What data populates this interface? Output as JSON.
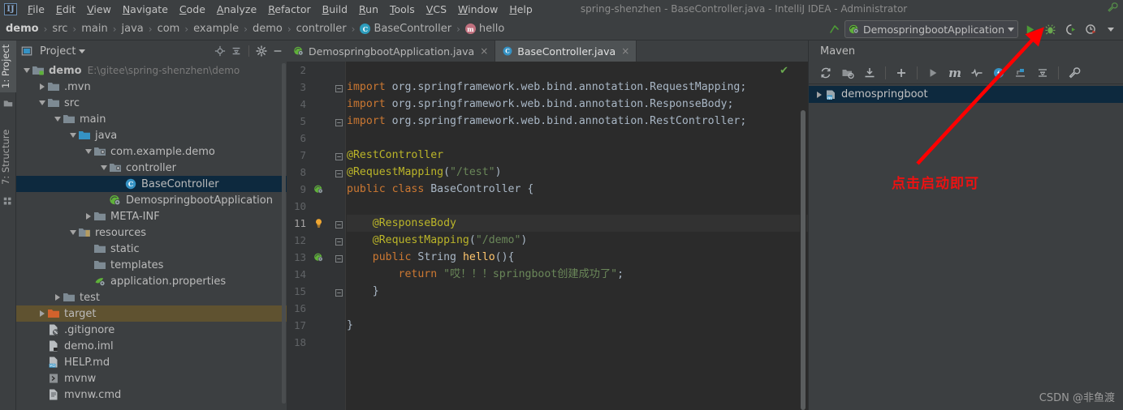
{
  "window": {
    "title": "spring-shenzhen - BaseController.java - IntelliJ IDEA - Administrator",
    "logo": "IJ"
  },
  "menubar": {
    "items": [
      {
        "label": "File",
        "mnemonic": "F"
      },
      {
        "label": "Edit",
        "mnemonic": "E"
      },
      {
        "label": "View",
        "mnemonic": "V"
      },
      {
        "label": "Navigate",
        "mnemonic": "N"
      },
      {
        "label": "Code",
        "mnemonic": "C"
      },
      {
        "label": "Analyze",
        "mnemonic": "A"
      },
      {
        "label": "Refactor",
        "mnemonic": "R"
      },
      {
        "label": "Build",
        "mnemonic": "B"
      },
      {
        "label": "Run",
        "mnemonic": "R"
      },
      {
        "label": "Tools",
        "mnemonic": "T"
      },
      {
        "label": "VCS",
        "mnemonic": "V"
      },
      {
        "label": "Window",
        "mnemonic": "W"
      },
      {
        "label": "Help",
        "mnemonic": "H"
      }
    ]
  },
  "breadcrumb": {
    "separator": "›",
    "items": [
      {
        "label": "demo",
        "icon": "none",
        "bold": true
      },
      {
        "label": "src",
        "icon": "none",
        "bold": false
      },
      {
        "label": "main",
        "icon": "none",
        "bold": false
      },
      {
        "label": "java",
        "icon": "none",
        "bold": false
      },
      {
        "label": "com",
        "icon": "none",
        "bold": false
      },
      {
        "label": "example",
        "icon": "none",
        "bold": false
      },
      {
        "label": "demo",
        "icon": "none",
        "bold": false
      },
      {
        "label": "controller",
        "icon": "none",
        "bold": false
      },
      {
        "label": "BaseController",
        "icon": "class-icon",
        "icon_letter": "C",
        "bold": false
      },
      {
        "label": "hello",
        "icon": "method-icon",
        "icon_letter": "m",
        "bold": false
      }
    ]
  },
  "run_toolbar": {
    "config_name": "DemospringbootApplication",
    "config_icon": "spring-boot-icon",
    "dropdown_icon": "chevron-down-icon",
    "buttons": [
      {
        "name": "run-button",
        "icon": "play-icon",
        "color": "#4d9a36"
      },
      {
        "name": "debug-button",
        "icon": "bug-icon",
        "color": "#6aa84f"
      },
      {
        "name": "run-with-coverage-button",
        "icon": "coverage-icon",
        "color": "#b0b0b0"
      },
      {
        "name": "profile-button",
        "icon": "profiler-icon",
        "color": "#b0b0b0"
      }
    ],
    "updown_icon": "updown-arrow-icon"
  },
  "tool_strip": {
    "tabs": [
      {
        "label": "1: Project",
        "active": true,
        "name": "tool-tab-project"
      },
      {
        "label": "7: Structure",
        "active": false,
        "name": "tool-tab-structure"
      }
    ]
  },
  "project_panel": {
    "title": "Project",
    "title_icon": "project-view-icon",
    "title_dropdown_icon": "chevron-down-icon",
    "toolbar": [
      {
        "name": "locate-icon",
        "label": "Select Opened File"
      },
      {
        "name": "collapse-all-icon",
        "label": "Collapse All"
      },
      {
        "name": "gear-icon",
        "label": "Settings"
      },
      {
        "name": "minimize-icon",
        "label": "Hide"
      }
    ],
    "tree": [
      {
        "label": "demo",
        "path": "E:\\gitee\\spring-shenzhen\\demo",
        "indent": 0,
        "arrow": "down",
        "icon": "module-folder-icon",
        "state": "normal",
        "bold": true
      },
      {
        "label": ".mvn",
        "path": "",
        "indent": 1,
        "arrow": "right",
        "icon": "folder-icon",
        "state": "normal",
        "bold": false
      },
      {
        "label": "src",
        "path": "",
        "indent": 1,
        "arrow": "down",
        "icon": "folder-icon",
        "state": "normal",
        "bold": false
      },
      {
        "label": "main",
        "path": "",
        "indent": 2,
        "arrow": "down",
        "icon": "folder-icon",
        "state": "normal",
        "bold": false
      },
      {
        "label": "java",
        "path": "",
        "indent": 3,
        "arrow": "down",
        "icon": "source-folder-icon",
        "state": "normal",
        "bold": false
      },
      {
        "label": "com.example.demo",
        "path": "",
        "indent": 4,
        "arrow": "down",
        "icon": "package-icon",
        "state": "normal",
        "bold": false
      },
      {
        "label": "controller",
        "path": "",
        "indent": 5,
        "arrow": "down",
        "icon": "package-icon",
        "state": "normal",
        "bold": false
      },
      {
        "label": "BaseController",
        "path": "",
        "indent": 6,
        "arrow": "none",
        "icon": "java-class-icon",
        "state": "selected",
        "bold": false
      },
      {
        "label": "DemospringbootApplication",
        "path": "",
        "indent": 5,
        "arrow": "none",
        "icon": "spring-boot-icon",
        "state": "normal",
        "bold": false
      },
      {
        "label": "META-INF",
        "path": "",
        "indent": 4,
        "arrow": "right",
        "icon": "folder-icon",
        "state": "normal",
        "bold": false
      },
      {
        "label": "resources",
        "path": "",
        "indent": 3,
        "arrow": "down",
        "icon": "resources-folder-icon",
        "state": "normal",
        "bold": false
      },
      {
        "label": "static",
        "path": "",
        "indent": 4,
        "arrow": "none",
        "icon": "folder-icon",
        "state": "normal",
        "bold": false
      },
      {
        "label": "templates",
        "path": "",
        "indent": 4,
        "arrow": "none",
        "icon": "folder-icon",
        "state": "normal",
        "bold": false
      },
      {
        "label": "application.properties",
        "path": "",
        "indent": 4,
        "arrow": "none",
        "icon": "spring-properties-icon",
        "state": "normal",
        "bold": false
      },
      {
        "label": "test",
        "path": "",
        "indent": 2,
        "arrow": "right",
        "icon": "folder-icon",
        "state": "normal",
        "bold": false
      },
      {
        "label": "target",
        "path": "",
        "indent": 1,
        "arrow": "right",
        "icon": "excluded-folder-icon",
        "state": "highlight",
        "bold": false
      },
      {
        "label": ".gitignore",
        "path": "",
        "indent": 1,
        "arrow": "none",
        "icon": "gitignore-file-icon",
        "state": "normal",
        "bold": false
      },
      {
        "label": "demo.iml",
        "path": "",
        "indent": 1,
        "arrow": "none",
        "icon": "iml-file-icon",
        "state": "normal",
        "bold": false
      },
      {
        "label": "HELP.md",
        "path": "",
        "indent": 1,
        "arrow": "none",
        "icon": "markdown-file-icon",
        "state": "normal",
        "bold": false
      },
      {
        "label": "mvnw",
        "path": "",
        "indent": 1,
        "arrow": "none",
        "icon": "script-file-icon",
        "state": "normal",
        "bold": false
      },
      {
        "label": "mvnw.cmd",
        "path": "",
        "indent": 1,
        "arrow": "none",
        "icon": "cmd-file-icon",
        "state": "normal",
        "bold": false
      }
    ]
  },
  "editor": {
    "tabs": [
      {
        "label": "DemospringbootApplication.java",
        "icon": "spring-boot-icon",
        "active": false,
        "close_icon": "×"
      },
      {
        "label": "BaseController.java",
        "icon": "java-class-icon",
        "active": true,
        "close_icon": "×"
      }
    ],
    "inspection_status_icon": "checkmark-icon",
    "current_line": 11,
    "lines": [
      {
        "num": "2",
        "fold": "none",
        "gutter_icon": "",
        "html": ""
      },
      {
        "num": "3",
        "fold": "open",
        "gutter_icon": "",
        "html": "<span class=\"kw\">import</span> <span class=\"pln\">org.springframework.web.bind.annotation.RequestMapping;</span>"
      },
      {
        "num": "4",
        "fold": "none",
        "gutter_icon": "",
        "html": "<span class=\"kw\">import</span> <span class=\"pln\">org.springframework.web.bind.annotation.ResponseBody;</span>"
      },
      {
        "num": "5",
        "fold": "close",
        "gutter_icon": "",
        "html": "<span class=\"kw\">import</span> <span class=\"pln\">org.springframework.web.bind.annotation.RestController;</span>"
      },
      {
        "num": "6",
        "fold": "none",
        "gutter_icon": "",
        "html": ""
      },
      {
        "num": "7",
        "fold": "open",
        "gutter_icon": "",
        "html": "<span class=\"ann\">@RestController</span>"
      },
      {
        "num": "8",
        "fold": "close",
        "gutter_icon": "",
        "html": "<span class=\"ann\">@RequestMapping</span><span class=\"pln\">(</span><span class=\"str\">\"/test\"</span><span class=\"pln\">)</span>"
      },
      {
        "num": "9",
        "fold": "none",
        "gutter_icon": "spring-bean-icon",
        "html": "<span class=\"kw\">public class</span> <span class=\"cls2\">BaseController</span> <span class=\"pln\">{</span>"
      },
      {
        "num": "10",
        "fold": "none",
        "gutter_icon": "",
        "html": ""
      },
      {
        "num": "11",
        "fold": "open",
        "gutter_icon": "lightbulb-icon",
        "html": "    <span class=\"ann\">@ResponseBody</span>"
      },
      {
        "num": "12",
        "fold": "close",
        "gutter_icon": "",
        "html": "    <span class=\"ann\">@RequestMapping</span><span class=\"pln\">(</span><span class=\"str\">\"/demo\"</span><span class=\"pln\">)</span>"
      },
      {
        "num": "13",
        "fold": "open",
        "gutter_icon": "spring-bean-icon",
        "html": "    <span class=\"kw\">public</span> <span class=\"cls2\">String</span> <span class=\"mtd\">hello</span><span class=\"pln\">(){</span>"
      },
      {
        "num": "14",
        "fold": "none",
        "gutter_icon": "",
        "html": "        <span class=\"kw\">return</span> <span class=\"str\">\"哎！！！springboot创建成功了\"</span><span class=\"pln\">;</span>"
      },
      {
        "num": "15",
        "fold": "close",
        "gutter_icon": "",
        "html": "    <span class=\"pln\">}</span>"
      },
      {
        "num": "16",
        "fold": "none",
        "gutter_icon": "",
        "html": ""
      },
      {
        "num": "17",
        "fold": "none",
        "gutter_icon": "",
        "html": "<span class=\"pln\">}</span>"
      },
      {
        "num": "18",
        "fold": "none",
        "gutter_icon": "",
        "html": ""
      }
    ]
  },
  "maven_panel": {
    "title": "Maven",
    "toolbar": [
      {
        "name": "reimport-icon",
        "label": "Reimport All Maven Projects"
      },
      {
        "name": "generate-sources-icon",
        "label": "Generate Sources and Update Folders"
      },
      {
        "name": "download-sources-icon",
        "label": "Download Sources and/or Documentation"
      },
      {
        "name": "add-maven-project-icon",
        "label": "Add Maven Projects"
      },
      {
        "name": "run-maven-build-icon",
        "label": "Run Maven Build"
      },
      {
        "name": "execute-maven-goal-icon",
        "label": "Execute Maven Goal"
      },
      {
        "name": "toggle-offline-icon",
        "label": "Toggle Offline Mode"
      },
      {
        "name": "toggle-skip-tests-icon",
        "label": "Toggle Skip Tests Mode"
      },
      {
        "name": "show-dependencies-icon",
        "label": "Show Dependencies"
      },
      {
        "name": "collapse-all-icon",
        "label": "Collapse All"
      },
      {
        "name": "maven-settings-icon",
        "label": "Maven Settings"
      }
    ],
    "tree": [
      {
        "label": "demospringboot",
        "arrow": "right",
        "icon": "maven-project-icon",
        "selected": true
      }
    ]
  },
  "annotations": {
    "callout_text": "点击启动即可",
    "callout_color": "#ee1111",
    "arrow_color": "#ff0000",
    "watermark": "CSDN @非鱼渡"
  }
}
